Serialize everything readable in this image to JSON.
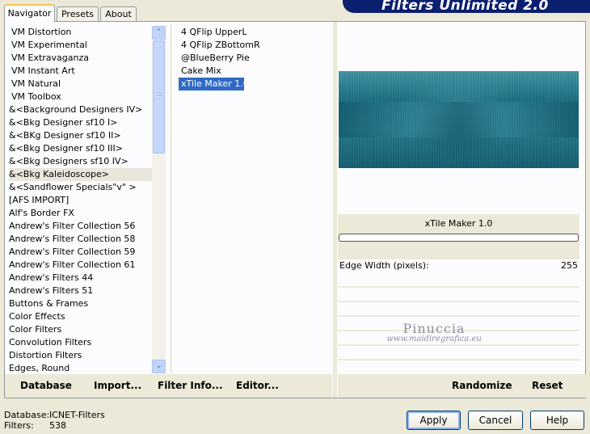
{
  "tabs": [
    {
      "label": "Navigator",
      "active": true
    },
    {
      "label": "Presets",
      "active": false
    },
    {
      "label": "About",
      "active": false
    }
  ],
  "banner": {
    "title": "Filters Unlimited 2.0"
  },
  "categories": [
    {
      "label": "VM Distortion",
      "indent": true
    },
    {
      "label": "VM Experimental",
      "indent": true
    },
    {
      "label": "VM Extravaganza",
      "indent": true
    },
    {
      "label": "VM Instant Art",
      "indent": true
    },
    {
      "label": "VM Natural",
      "indent": true
    },
    {
      "label": "VM Toolbox",
      "indent": true
    },
    {
      "label": "&<Background Designers IV>"
    },
    {
      "label": "&<Bkg Designer sf10 I>"
    },
    {
      "label": "&<BKg Designer sf10 II>"
    },
    {
      "label": "&<Bkg Designer sf10 III>"
    },
    {
      "label": "&<Bkg Designers sf10 IV>"
    },
    {
      "label": "&<Bkg Kaleidoscope>",
      "selected": true
    },
    {
      "label": "&<Sandflower Specials\"v\" >"
    },
    {
      "label": "[AFS IMPORT]"
    },
    {
      "label": "Alf's Border FX"
    },
    {
      "label": "Andrew's Filter Collection 56"
    },
    {
      "label": "Andrew's Filter Collection 58"
    },
    {
      "label": "Andrew's Filter Collection 59"
    },
    {
      "label": "Andrew's Filter Collection 61"
    },
    {
      "label": "Andrew's Filters 44"
    },
    {
      "label": "Andrew's Filters 51"
    },
    {
      "label": "Buttons & Frames"
    },
    {
      "label": "Color Effects"
    },
    {
      "label": "Color Filters"
    },
    {
      "label": "Convolution Filters"
    },
    {
      "label": "Distortion Filters"
    },
    {
      "label": "Edges, Round"
    }
  ],
  "filters": [
    {
      "label": "4 QFlip UpperL"
    },
    {
      "label": "4 QFlip ZBottomR"
    },
    {
      "label": "@BlueBerry Pie"
    },
    {
      "label": "Cake Mix"
    },
    {
      "label": "xTile Maker 1.0",
      "selected": true
    }
  ],
  "scroll": {
    "up_glyph": "⌃",
    "down_glyph": "⌄",
    "grip": "≡"
  },
  "selected_filter_name": "xTile Maker 1.0",
  "params": [
    {
      "label": "Edge Width (pixels):",
      "value": "255"
    }
  ],
  "watermark": {
    "line1": "Pinuccia",
    "line2": "www.maidiregrafica.eu"
  },
  "toolbar": {
    "database": "Database",
    "import": "Import...",
    "filter_info": "Filter Info...",
    "editor": "Editor...",
    "randomize": "Randomize",
    "reset": "Reset"
  },
  "status": {
    "database_label": "Database:",
    "database_value": "ICNET-Filters",
    "filters_label": "Filters:",
    "filters_value": "538"
  },
  "buttons": {
    "apply": "Apply",
    "cancel": "Cancel",
    "help": "Help"
  }
}
